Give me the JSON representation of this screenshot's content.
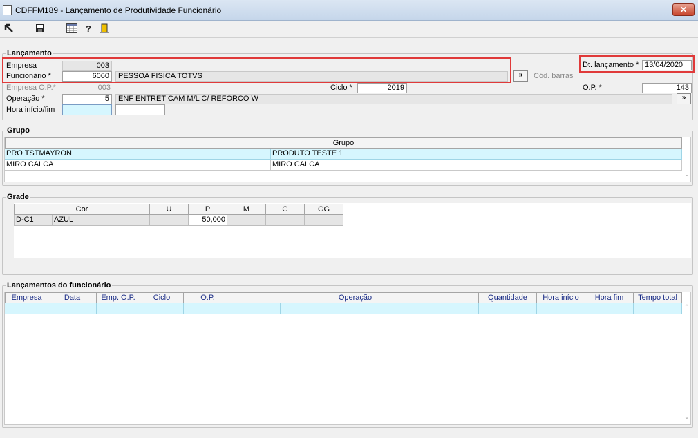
{
  "window": {
    "title": "CDFFM189 - Lançamento de Produtividade Funcionário",
    "close_label": "✕"
  },
  "toolbar": {
    "icons": [
      "exit-icon",
      "save-icon",
      "calculator-icon",
      "help-icon",
      "door-exit-icon"
    ]
  },
  "lancamento": {
    "legend": "Lançamento",
    "empresa_label": "Empresa",
    "empresa_value": "003",
    "funcionario_label": "Funcionário *",
    "funcionario_code": "6060",
    "funcionario_name": "PESSOA FISICA TOTVS",
    "more_button": "»",
    "cod_barras_label": "Cód. barras",
    "dt_label": "Dt. lançamento *",
    "dt_value": "13/04/2020",
    "empresa_op_label": "Empresa O.P.*",
    "empresa_op_value": "003",
    "ciclo_label": "Ciclo *",
    "ciclo_value": "2019",
    "op_label": "O.P. *",
    "op_value": "143",
    "operacao_label": "Operação *",
    "operacao_code": "5",
    "operacao_desc": "ENF ENTRET CAM M/L C/ REFORCO W",
    "hora_label": "Hora início/fim",
    "hora_inicio": "",
    "hora_fim": ""
  },
  "grupo": {
    "legend": "Grupo",
    "header": "Grupo",
    "rows": [
      {
        "code": "PRO TSTMAYRON",
        "desc": "PRODUTO TESTE 1"
      },
      {
        "code": "MIRO CALCA",
        "desc": "MIRO CALCA"
      }
    ]
  },
  "grade": {
    "legend": "Grade",
    "headers": [
      "Cor",
      "U",
      "P",
      "M",
      "G",
      "GG"
    ],
    "row": {
      "code": "D-C1",
      "cor": "AZUL",
      "u": "",
      "p": "50,000",
      "m": "",
      "g": "",
      "gg": ""
    }
  },
  "lancamentos": {
    "legend": "Lançamentos do funcionário",
    "headers": [
      "Empresa",
      "Data",
      "Emp. O.P.",
      "Ciclo",
      "O.P.",
      "Operação",
      "Quantidade",
      "Hora início",
      "Hora fim",
      "Tempo total"
    ]
  }
}
